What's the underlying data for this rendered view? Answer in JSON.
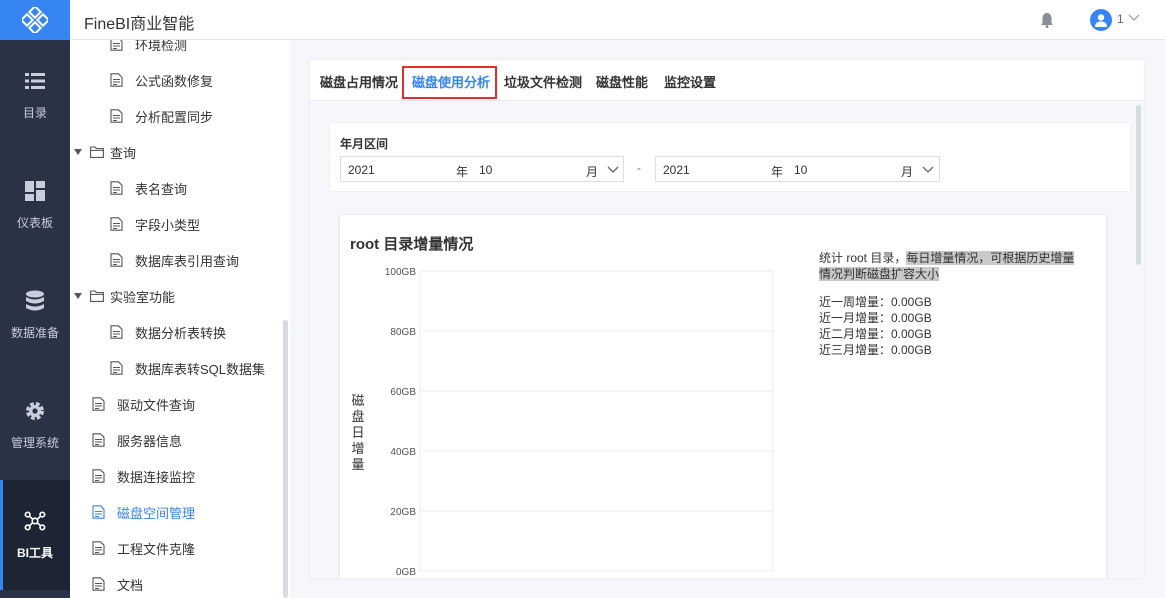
{
  "app": {
    "title": "FineBI商业智能"
  },
  "user": {
    "count": "1"
  },
  "rail": [
    {
      "label": "目录",
      "icon": "list-icon"
    },
    {
      "label": "仪表板",
      "icon": "dashboard-icon"
    },
    {
      "label": "数据准备",
      "icon": "database-icon"
    },
    {
      "label": "管理系统",
      "icon": "gear-icon"
    },
    {
      "label": "BI工具",
      "icon": "network-icon"
    }
  ],
  "tree": [
    {
      "label": "环境检测",
      "level": 2
    },
    {
      "label": "公式函数修复",
      "level": 2
    },
    {
      "label": "分析配置同步",
      "level": 2
    },
    {
      "label": "查询",
      "level": 1,
      "folder": true
    },
    {
      "label": "表名查询",
      "level": 2
    },
    {
      "label": "字段小类型",
      "level": 2
    },
    {
      "label": "数据库表引用查询",
      "level": 2
    },
    {
      "label": "实验室功能",
      "level": 1,
      "folder": true
    },
    {
      "label": "数据分析表转换",
      "level": 2
    },
    {
      "label": "数据库表转SQL数据集",
      "level": 2
    },
    {
      "label": "驱动文件查询",
      "level": 1
    },
    {
      "label": "服务器信息",
      "level": 1
    },
    {
      "label": "数据连接监控",
      "level": 1
    },
    {
      "label": "磁盘空间管理",
      "level": 1,
      "active": true
    },
    {
      "label": "工程文件克隆",
      "level": 1
    },
    {
      "label": "文档",
      "level": 1
    }
  ],
  "tabs": [
    "磁盘占用情况",
    "磁盘使用分析",
    "垃圾文件检测",
    "磁盘性能",
    "监控设置"
  ],
  "filter": {
    "label": "年月区间",
    "start": {
      "year": "2021",
      "year_label": "年",
      "month": "10",
      "month_label": "月"
    },
    "separator": "-",
    "end": {
      "year": "2021",
      "year_label": "年",
      "month": "10",
      "month_label": "月"
    }
  },
  "chart": {
    "description_plain": "统计 root 目录，",
    "description_highlight_1": "每日增量情况，可根据历史增量",
    "description_highlight_2": "情况判断磁盘扩容大小",
    "stats": [
      "近一周增量：0.00GB",
      "近一月增量：0.00GB",
      "近二月增量：0.00GB",
      "近三月增量：0.00GB"
    ]
  },
  "colors": {
    "accent": "#3685f2",
    "rail": "#2a3346",
    "highlight_box": "#e0302b"
  },
  "chart_data": {
    "type": "bar",
    "title": "root 目录增量情况",
    "ylabel": "磁盘日增量",
    "xlabel": "",
    "yticks": [
      "0GB",
      "20GB",
      "40GB",
      "60GB",
      "80GB",
      "100GB"
    ],
    "ylim": [
      0,
      100
    ],
    "categories": [],
    "values": [],
    "grid": true
  }
}
